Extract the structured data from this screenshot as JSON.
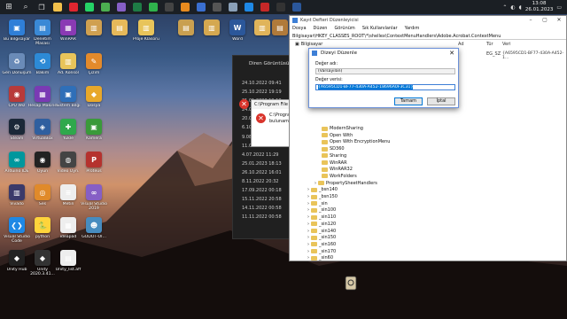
{
  "taskbar": {
    "clock_time": "13:08",
    "clock_date": "26.01.2023",
    "apps": [
      {
        "name": "start",
        "color": "#ffffff"
      },
      {
        "name": "search",
        "color": "#cccccc"
      },
      {
        "name": "task-view",
        "color": "#cccccc"
      },
      {
        "name": "file-explorer",
        "color": "#f2c04b"
      },
      {
        "name": "opera",
        "color": "#e0262f"
      },
      {
        "name": "whatsapp",
        "color": "#25d366"
      },
      {
        "name": "chrome",
        "color": "#4caf50"
      },
      {
        "name": "visual-studio",
        "color": "#865fc5"
      },
      {
        "name": "excel",
        "color": "#1e7b45"
      },
      {
        "name": "app-green",
        "color": "#2fb24c"
      },
      {
        "name": "terminal",
        "color": "#444444"
      },
      {
        "name": "app-orange",
        "color": "#e78a1e"
      },
      {
        "name": "photos",
        "color": "#3a6fd0"
      },
      {
        "name": "app-dark",
        "color": "#555555"
      },
      {
        "name": "settings",
        "color": "#8aa0b8"
      },
      {
        "name": "ie",
        "color": "#1e88e5"
      },
      {
        "name": "app-red",
        "color": "#c62828"
      },
      {
        "name": "obs",
        "color": "#333333"
      },
      {
        "name": "word",
        "color": "#2b579a"
      }
    ]
  },
  "desktop_icons": [
    {
      "label": "Bu Bilgisayar",
      "color": "#2f7fd8",
      "glyph": "▣"
    },
    {
      "label": "Denetim Masası",
      "color": "#3a89d6",
      "glyph": "▤"
    },
    {
      "label": "WinRAR",
      "color": "#8a3ab4",
      "glyph": "▦"
    },
    {
      "label": "",
      "color": "#d0a050",
      "glyph": "▥"
    },
    {
      "label": "",
      "color": "#e6b95a",
      "glyph": "▤"
    },
    {
      "label": "Proje Klasörü",
      "color": "#e8c45a",
      "glyph": "▥"
    },
    {
      "label": "",
      "color": "#c9a050",
      "glyph": "▤"
    },
    {
      "label": "",
      "color": "#d4a850",
      "glyph": "▥"
    },
    {
      "label": "Word",
      "color": "#2b579a",
      "glyph": "W"
    },
    {
      "label": "",
      "color": "#e0b45a",
      "glyph": "▥"
    },
    {
      "label": "",
      "color": "#b07a3a",
      "glyph": "▤"
    },
    {
      "label": "",
      "color": "#ddd",
      "glyph": "▢"
    },
    {
      "label": "Geri Dönüşüm",
      "color": "#6a8bb8",
      "glyph": "♻"
    },
    {
      "label": "Bakım",
      "color": "#2d8ad6",
      "glyph": "⟲"
    },
    {
      "label": "Ad. Konsol",
      "color": "#e8c45a",
      "glyph": "▥"
    },
    {
      "label": "Çizim",
      "color": "#e38a2b",
      "glyph": "✎"
    },
    {
      "label": "CPU Wiz",
      "color": "#b83a3a",
      "glyph": "◉"
    },
    {
      "label": "Hesap Makine",
      "color": "#7a3ab4",
      "glyph": "▦"
    },
    {
      "label": "Sistem Bilgi",
      "color": "#2f6fb8",
      "glyph": "▣"
    },
    {
      "label": "Dosya",
      "color": "#e8a82a",
      "glyph": "◆"
    },
    {
      "label": "Steam",
      "color": "#1b2838",
      "glyph": "⚙"
    },
    {
      "label": "VirtualBox",
      "color": "#2f5f9f",
      "glyph": "◈"
    },
    {
      "label": "Yükle",
      "color": "#2fa84c",
      "glyph": "✚"
    },
    {
      "label": "Kamera",
      "color": "#3a9a3a",
      "glyph": "▣"
    },
    {
      "label": "Arduino IDE",
      "color": "#00979d",
      "glyph": "∞"
    },
    {
      "label": "Oyun",
      "color": "#222",
      "glyph": "◉"
    },
    {
      "label": "Video Oyn.",
      "color": "#444",
      "glyph": "◍"
    },
    {
      "label": "Proteus",
      "color": "#b5322e",
      "glyph": "P"
    },
    {
      "label": "Vivado",
      "color": "#3a3a6a",
      "glyph": "▥"
    },
    {
      "label": "Ses",
      "color": "#e08a2a",
      "glyph": "◎"
    },
    {
      "label": "Metin",
      "color": "#eee",
      "glyph": "≡"
    },
    {
      "label": "Visual Studio 2019",
      "color": "#865fc5",
      "glyph": "∞"
    },
    {
      "label": "Visual Studio Code",
      "color": "#1e88e5",
      "glyph": "❮❯"
    },
    {
      "label": "python",
      "color": "#ffd43b",
      "glyph": "🐍"
    },
    {
      "label": "ideapad",
      "color": "#eee",
      "glyph": "▦"
    },
    {
      "label": "GODOT-Oİ...",
      "color": "#478cbf",
      "glyph": "☻"
    },
    {
      "label": "Unity Hub",
      "color": "#222",
      "glyph": "◆"
    },
    {
      "label": "Unity 2020.3.41...",
      "color": "#333",
      "glyph": "◆"
    },
    {
      "label": "Unity_list.aff",
      "color": "#eee",
      "glyph": "▤"
    }
  ],
  "dark_panel": {
    "header": "Diren Görüntüsü",
    "dates": [
      "24.10.2022 09:41",
      "25.10.2022 19:19",
      "21.01.2023 19:19",
      "24.01.2023 23:54",
      "20.09.2022 13:31",
      "6.10.2022 06:42",
      "9.08.2022 20:32",
      "11.02.2022 00:57",
      "4.07.2022 11:29",
      "25.01.2023 18:13",
      "26.10.2022 16:01",
      "8.11.2022 20:32",
      "17.09.2022 00:18",
      "15.11.2022 20:58",
      "14.11.2022 00:58",
      "11.11.2022 00:58"
    ]
  },
  "error_dialog": {
    "title": "C:\\Program File",
    "message_line1": "C:\\Progra",
    "message_line2": "bulunam",
    "icon": "error-icon"
  },
  "regedit": {
    "title": "Kayıt Defteri Düzenleyicisi",
    "menu": [
      "Dosya",
      "Düzen",
      "Görünüm",
      "Sık Kullanılanlar",
      "Yardım"
    ],
    "address": "Bilgisayar\\HKEY_CLASSES_ROOT\\*\\shellex\\ContextMenuHandlers\\Adobe.Acrobat.ContextMenu",
    "root_label": "Bilgisayar",
    "col_name": "Ad",
    "col_type": "Tür",
    "col_data": "Veri",
    "row_type": "EG_SZ",
    "row_value": "{A6595CD1-BF77-430A-A452-1...",
    "tree_items": [
      {
        "label": "ModernSharing",
        "indent": 1
      },
      {
        "label": "Open With",
        "indent": 1
      },
      {
        "label": "Open With EncryptionMenu",
        "indent": 1
      },
      {
        "label": "SD360",
        "indent": 1
      },
      {
        "label": "Sharing",
        "indent": 1
      },
      {
        "label": "WinRAR",
        "indent": 1
      },
      {
        "label": "WinRAR32",
        "indent": 1
      },
      {
        "label": "WorkFolders",
        "indent": 1
      },
      {
        "label": "PropertySheetHandlers",
        "indent": 0
      },
      {
        "label": "_bsn140",
        "indent": -1
      },
      {
        "label": "_bsn150",
        "indent": -1
      },
      {
        "label": "_sin",
        "indent": -1
      },
      {
        "label": "_sin100",
        "indent": -1
      },
      {
        "label": "_sin110",
        "indent": -1
      },
      {
        "label": "_sin120",
        "indent": -1
      },
      {
        "label": "_sin140",
        "indent": -1
      },
      {
        "label": "_sin150",
        "indent": -1
      },
      {
        "label": "_sin160",
        "indent": -1
      },
      {
        "label": "_sin170",
        "indent": -1
      },
      {
        "label": "_sin60",
        "indent": -1
      },
      {
        "label": "_sin71",
        "indent": -1
      },
      {
        "label": "_sin80",
        "indent": -1
      }
    ]
  },
  "edit_dialog": {
    "title": "Dizeyi Düzenle",
    "value_name_label": "Değer adı:",
    "value_name": "(Varsayılan)",
    "value_data_label": "Değer verisi:",
    "value_data": "{A6595CD1-BF77-430A-A452-18696A0F3C31}",
    "ok_label": "Tamam",
    "cancel_label": "İptal"
  }
}
